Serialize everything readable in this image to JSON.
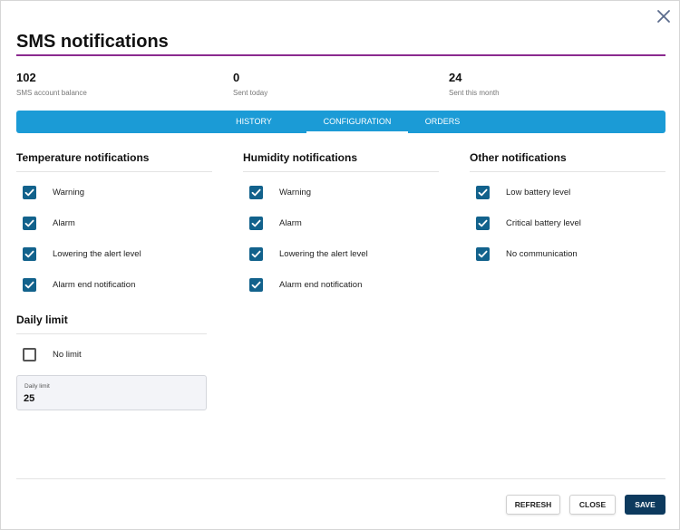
{
  "dialog": {
    "title": "SMS notifications",
    "accent_color": "#8b2a8f"
  },
  "stats": [
    {
      "value": "102",
      "label": "SMS account balance"
    },
    {
      "value": "0",
      "label": "Sent today"
    },
    {
      "value": "24",
      "label": "Sent this month"
    }
  ],
  "tabs": {
    "color": "#1b9bd6",
    "items": [
      {
        "label": "HISTORY",
        "active": false
      },
      {
        "label": "CONFIGURATION",
        "active": true
      },
      {
        "label": "ORDERS",
        "active": false
      }
    ]
  },
  "temperature": {
    "title": "Temperature notifications",
    "items": [
      {
        "label": "Warning",
        "checked": true
      },
      {
        "label": "Alarm",
        "checked": true
      },
      {
        "label": "Lowering the alert level",
        "checked": true
      },
      {
        "label": "Alarm end notification",
        "checked": true
      }
    ]
  },
  "humidity": {
    "title": "Humidity notifications",
    "items": [
      {
        "label": "Warning",
        "checked": true
      },
      {
        "label": "Alarm",
        "checked": true
      },
      {
        "label": "Lowering the alert level",
        "checked": true
      },
      {
        "label": "Alarm end notification",
        "checked": true
      }
    ]
  },
  "other": {
    "title": "Other notifications",
    "items": [
      {
        "label": "Low battery level",
        "checked": true
      },
      {
        "label": "Critical battery level",
        "checked": true
      },
      {
        "label": "No communication",
        "checked": true
      }
    ]
  },
  "daily_limit": {
    "title": "Daily limit",
    "no_limit_label": "No limit",
    "no_limit_checked": false,
    "field_label": "Daily limit",
    "field_value": "25"
  },
  "footer": {
    "refresh_label": "REFRESH",
    "close_label": "CLOSE",
    "save_label": "SAVE",
    "save_color": "#0d3a5e"
  },
  "icons": {
    "close": "close-icon",
    "check": "check-icon"
  }
}
